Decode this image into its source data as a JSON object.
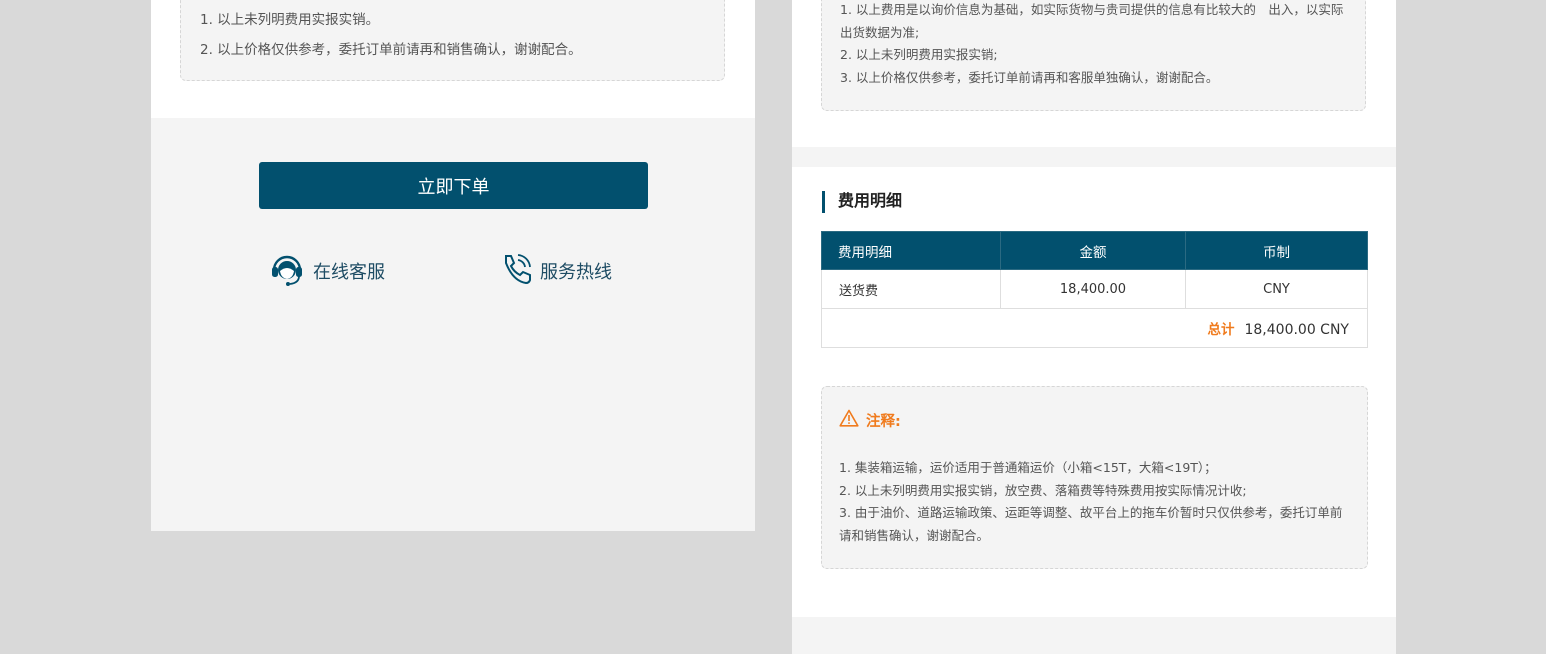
{
  "left": {
    "notes": [
      "1. 以上未列明费用实报实销。",
      "2. 以上价格仅供参考，委托订单前请再和销售确认，谢谢配合。"
    ],
    "order_button": "立即下单",
    "service_label": "在线客服",
    "hotline_label": "服务热线"
  },
  "right": {
    "top_notes": [
      "1. 以上费用是以询价信息为基础，如实际货物与贵司提供的信息有比较大的　出入，以实际出货数据为准;",
      "2. 以上未列明费用实报实销;",
      "3. 以上价格仅供参考，委托订单前请再和客服单独确认，谢谢配合。"
    ],
    "section_title": "费用明细",
    "table": {
      "headers": [
        "费用明细",
        "金额",
        "币制"
      ],
      "rows": [
        [
          "送货费",
          "18,400.00",
          "CNY"
        ]
      ],
      "total_label": "总计",
      "total_value": "18,400.00 CNY"
    },
    "remark_title": "注释:",
    "remarks": [
      "1. 集装箱运输，运价适用于普通箱运价（小箱<15T，大箱<19T）；",
      "2. 以上未列明费用实报实销，放空费、落箱费等特殊费用按实际情况计收;",
      "3. 由于油价、道路运输政策、运距等调整、故平台上的拖车价暂时只仅供参考，委托订单前请和销售确认，谢谢配合。"
    ]
  },
  "colors": {
    "primary": "#02506e",
    "accent": "#f07b1d",
    "page_bg": "#d9d9d9",
    "panel_bg": "#f4f4f4"
  },
  "icons": [
    "headset-icon",
    "phone-icon",
    "warning-icon"
  ]
}
